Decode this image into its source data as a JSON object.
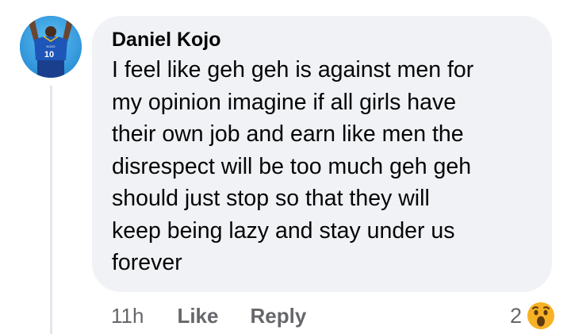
{
  "comment": {
    "author": "Daniel Kojo",
    "lines": [
      "I feel like geh geh is against men for",
      "my opinion imagine if all girls have",
      "their own job and earn like men the",
      "disrespect will be too much geh geh",
      "should just stop so that they will",
      "keep being lazy and stay under us",
      "forever"
    ],
    "avatar": {
      "icon": "avatar-photo",
      "jersey_number": "10",
      "jersey_name": "KOJO"
    }
  },
  "actions": {
    "time": "11h",
    "like_label": "Like",
    "reply_label": "Reply"
  },
  "reactions": {
    "count": "2",
    "icon": "wow-emoji-icon"
  },
  "colors": {
    "bubble_bg": "#f0f2f5",
    "text": "#050505",
    "secondary_text": "#65676b",
    "reaction_yellow": "#f7b125"
  }
}
